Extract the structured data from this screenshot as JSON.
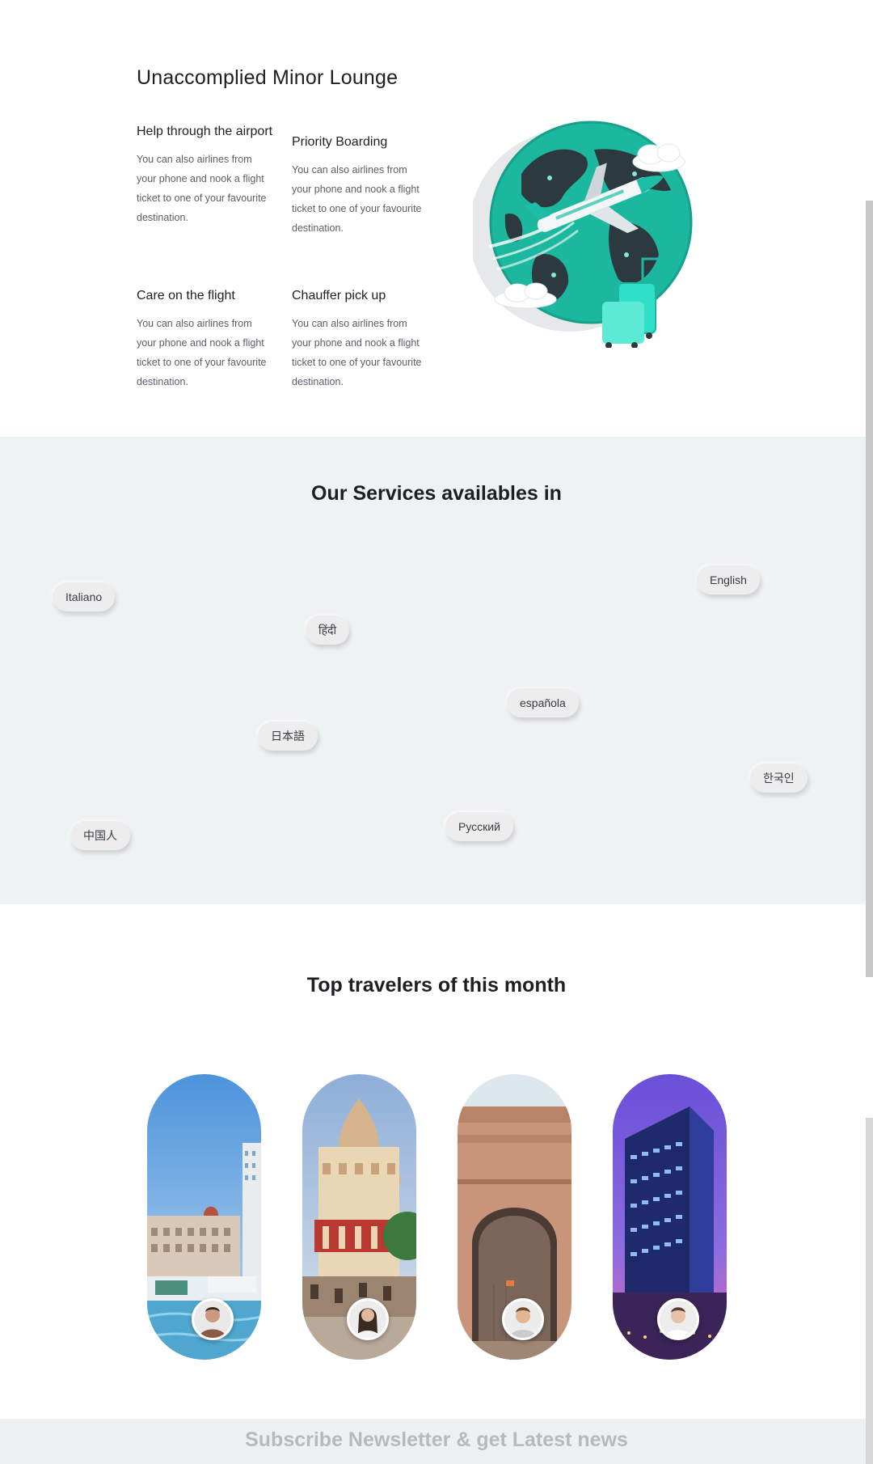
{
  "lounge": {
    "title": "Unaccomplied Minor Lounge",
    "features": [
      {
        "title": "Help through the airport",
        "text": "You can also airlines from your phone and nook a flight ticket to one of your favourite destination."
      },
      {
        "title": "Priority Boarding",
        "text": "You can also airlines from your phone and nook a flight ticket to one of your favourite destination."
      },
      {
        "title": "Care on the flight",
        "text": "You can also airlines from your phone and nook a flight ticket to one of your favourite destination."
      },
      {
        "title": "Chauffer pick up",
        "text": "You can also airlines from your phone and nook a flight ticket to one of your favourite destination."
      }
    ],
    "illustration_icon": "globe-airplane-luggage-illustration"
  },
  "languages": {
    "title": "Our Services availables in",
    "items": [
      "English",
      "Italiano",
      "हिंदी",
      "española",
      "日本語",
      "한국인",
      "中国人",
      "Русский"
    ]
  },
  "travelers": {
    "title": "Top travelers of this month",
    "cards": [
      {
        "scene": "mumbai-waterfront-photo",
        "avatar": "male-traveler-avatar"
      },
      {
        "scene": "kolkata-temple-photo",
        "avatar": "female-traveler-avatar"
      },
      {
        "scene": "india-gate-photo",
        "avatar": "male-traveler-avatar"
      },
      {
        "scene": "purple-skyscraper-photo",
        "avatar": "male-traveler-avatar"
      }
    ]
  },
  "newsletter": {
    "title": "Subscribe Newsletter & get Latest news"
  },
  "colors": {
    "accent_teal": "#1cbfa6",
    "section_gray": "#eff2f3",
    "heading": "#1d1f24",
    "body_text": "#5b5e66"
  }
}
